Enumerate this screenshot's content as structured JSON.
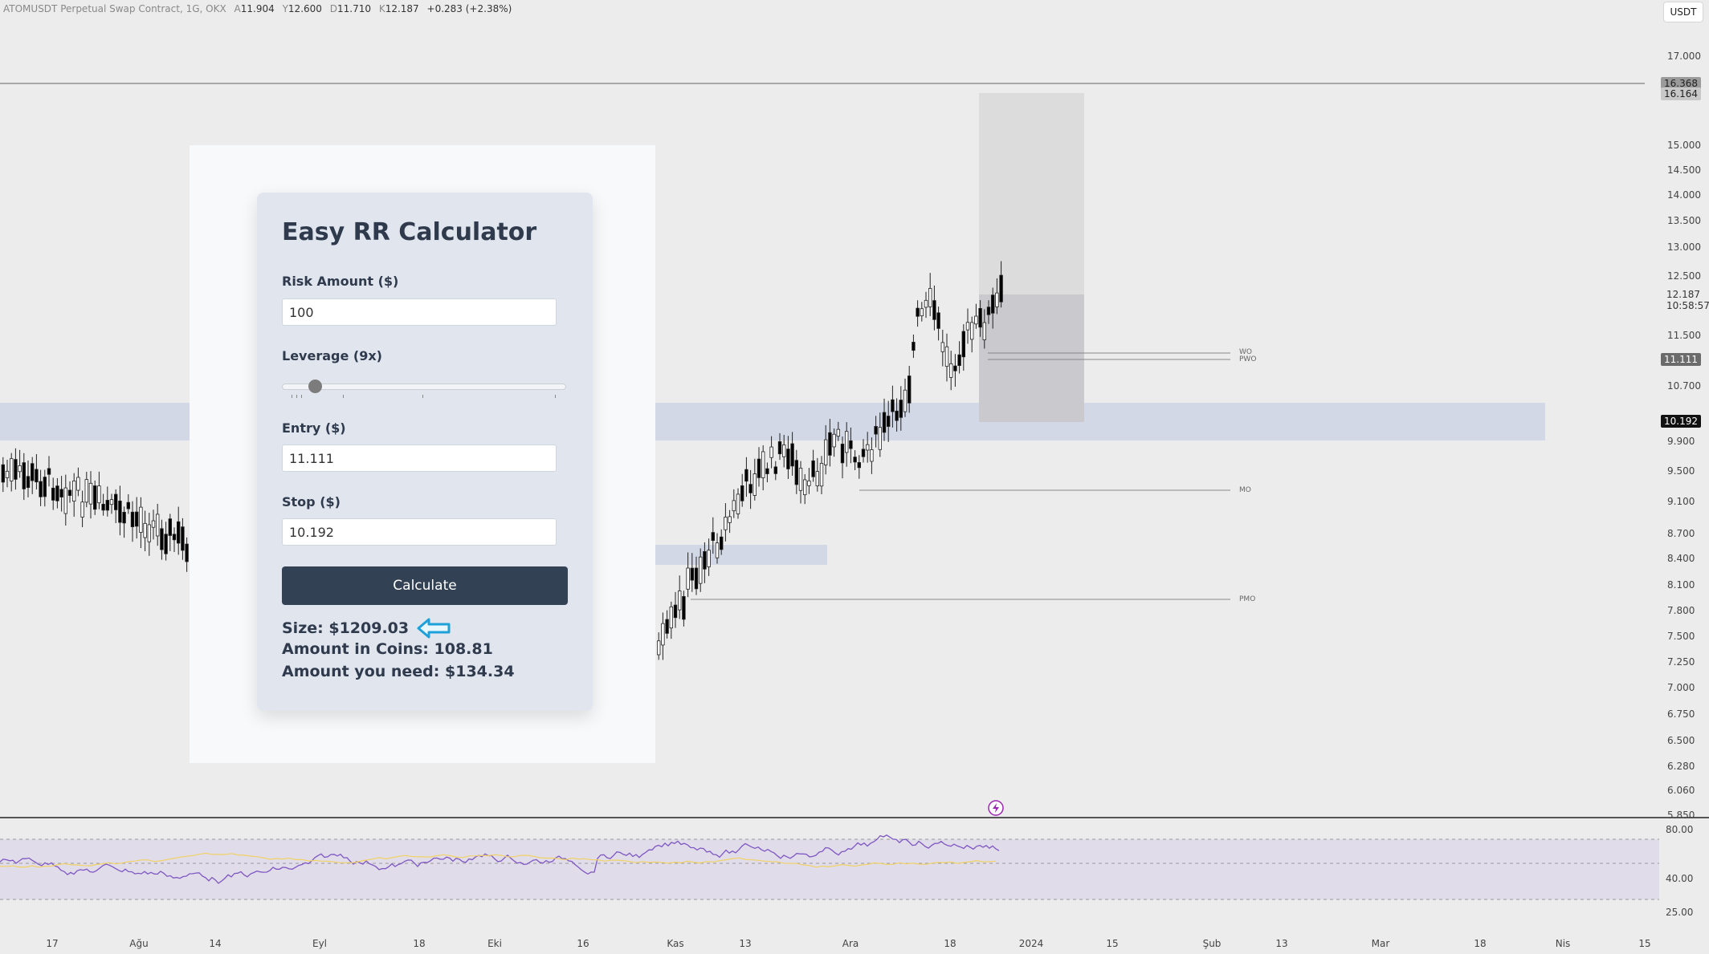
{
  "ohlc": {
    "symbol": "ATOMUSDT Perpetual Swap Contract, 1G, OKX",
    "open_label": "A",
    "open": "11.904",
    "high_label": "Y",
    "high": "12.600",
    "low_label": "D",
    "low": "11.710",
    "close_label": "K",
    "close": "12.187",
    "change": "+0.283 (+2.38%)"
  },
  "currency": "USDT",
  "price_scale": {
    "ticks": [
      "17.000",
      "15.000",
      "14.500",
      "14.000",
      "13.500",
      "13.000",
      "12.500",
      "11.500",
      "10.700",
      "9.900",
      "9.500",
      "9.100",
      "8.700",
      "8.400",
      "8.100",
      "7.800",
      "7.500",
      "7.250",
      "7.000",
      "6.750",
      "6.500",
      "6.280",
      "6.060",
      "5.850"
    ],
    "badge_top1": "16.368",
    "badge_top2": "16.164",
    "current_price": "12.187",
    "countdown": "10:58:57",
    "entry_badge": "11.111",
    "stop_badge": "10.192"
  },
  "rsi_scale": [
    "80.00",
    "40.00",
    "25.00"
  ],
  "level_labels": {
    "wo": "WO",
    "pwo": "PWO",
    "mo": "MO",
    "pmo": "PMO"
  },
  "time_axis": [
    "17",
    "Ağu",
    "14",
    "Eyl",
    "18",
    "Eki",
    "16",
    "Kas",
    "13",
    "Ara",
    "18",
    "2024",
    "15",
    "Şub",
    "13",
    "Mar",
    "18",
    "Nis",
    "15"
  ],
  "calculator": {
    "title": "Easy RR Calculator",
    "risk_label": "Risk Amount ($)",
    "risk_value": "100",
    "leverage_label": "Leverage (9x)",
    "leverage_value": 9,
    "entry_label": "Entry ($)",
    "entry_value": "11.111",
    "stop_label": "Stop ($)",
    "stop_value": "10.192",
    "button_label": "Calculate",
    "size_text": "Size: $1209.03",
    "coins_text": "Amount in Coins: 108.81",
    "need_text": "Amount you need: $134.34"
  },
  "colors": {
    "bull_candle": "#ffffff",
    "bear_candle": "#000000",
    "zone_blue": "#d2d8e6",
    "rsi_line": "#7e57c2",
    "rsi_ma": "#f0d264",
    "calc_button": "#334155",
    "arrow": "#1ea0d8"
  },
  "icons": {
    "arrow": "arrow-left-icon",
    "lightning": "lightning-icon"
  }
}
